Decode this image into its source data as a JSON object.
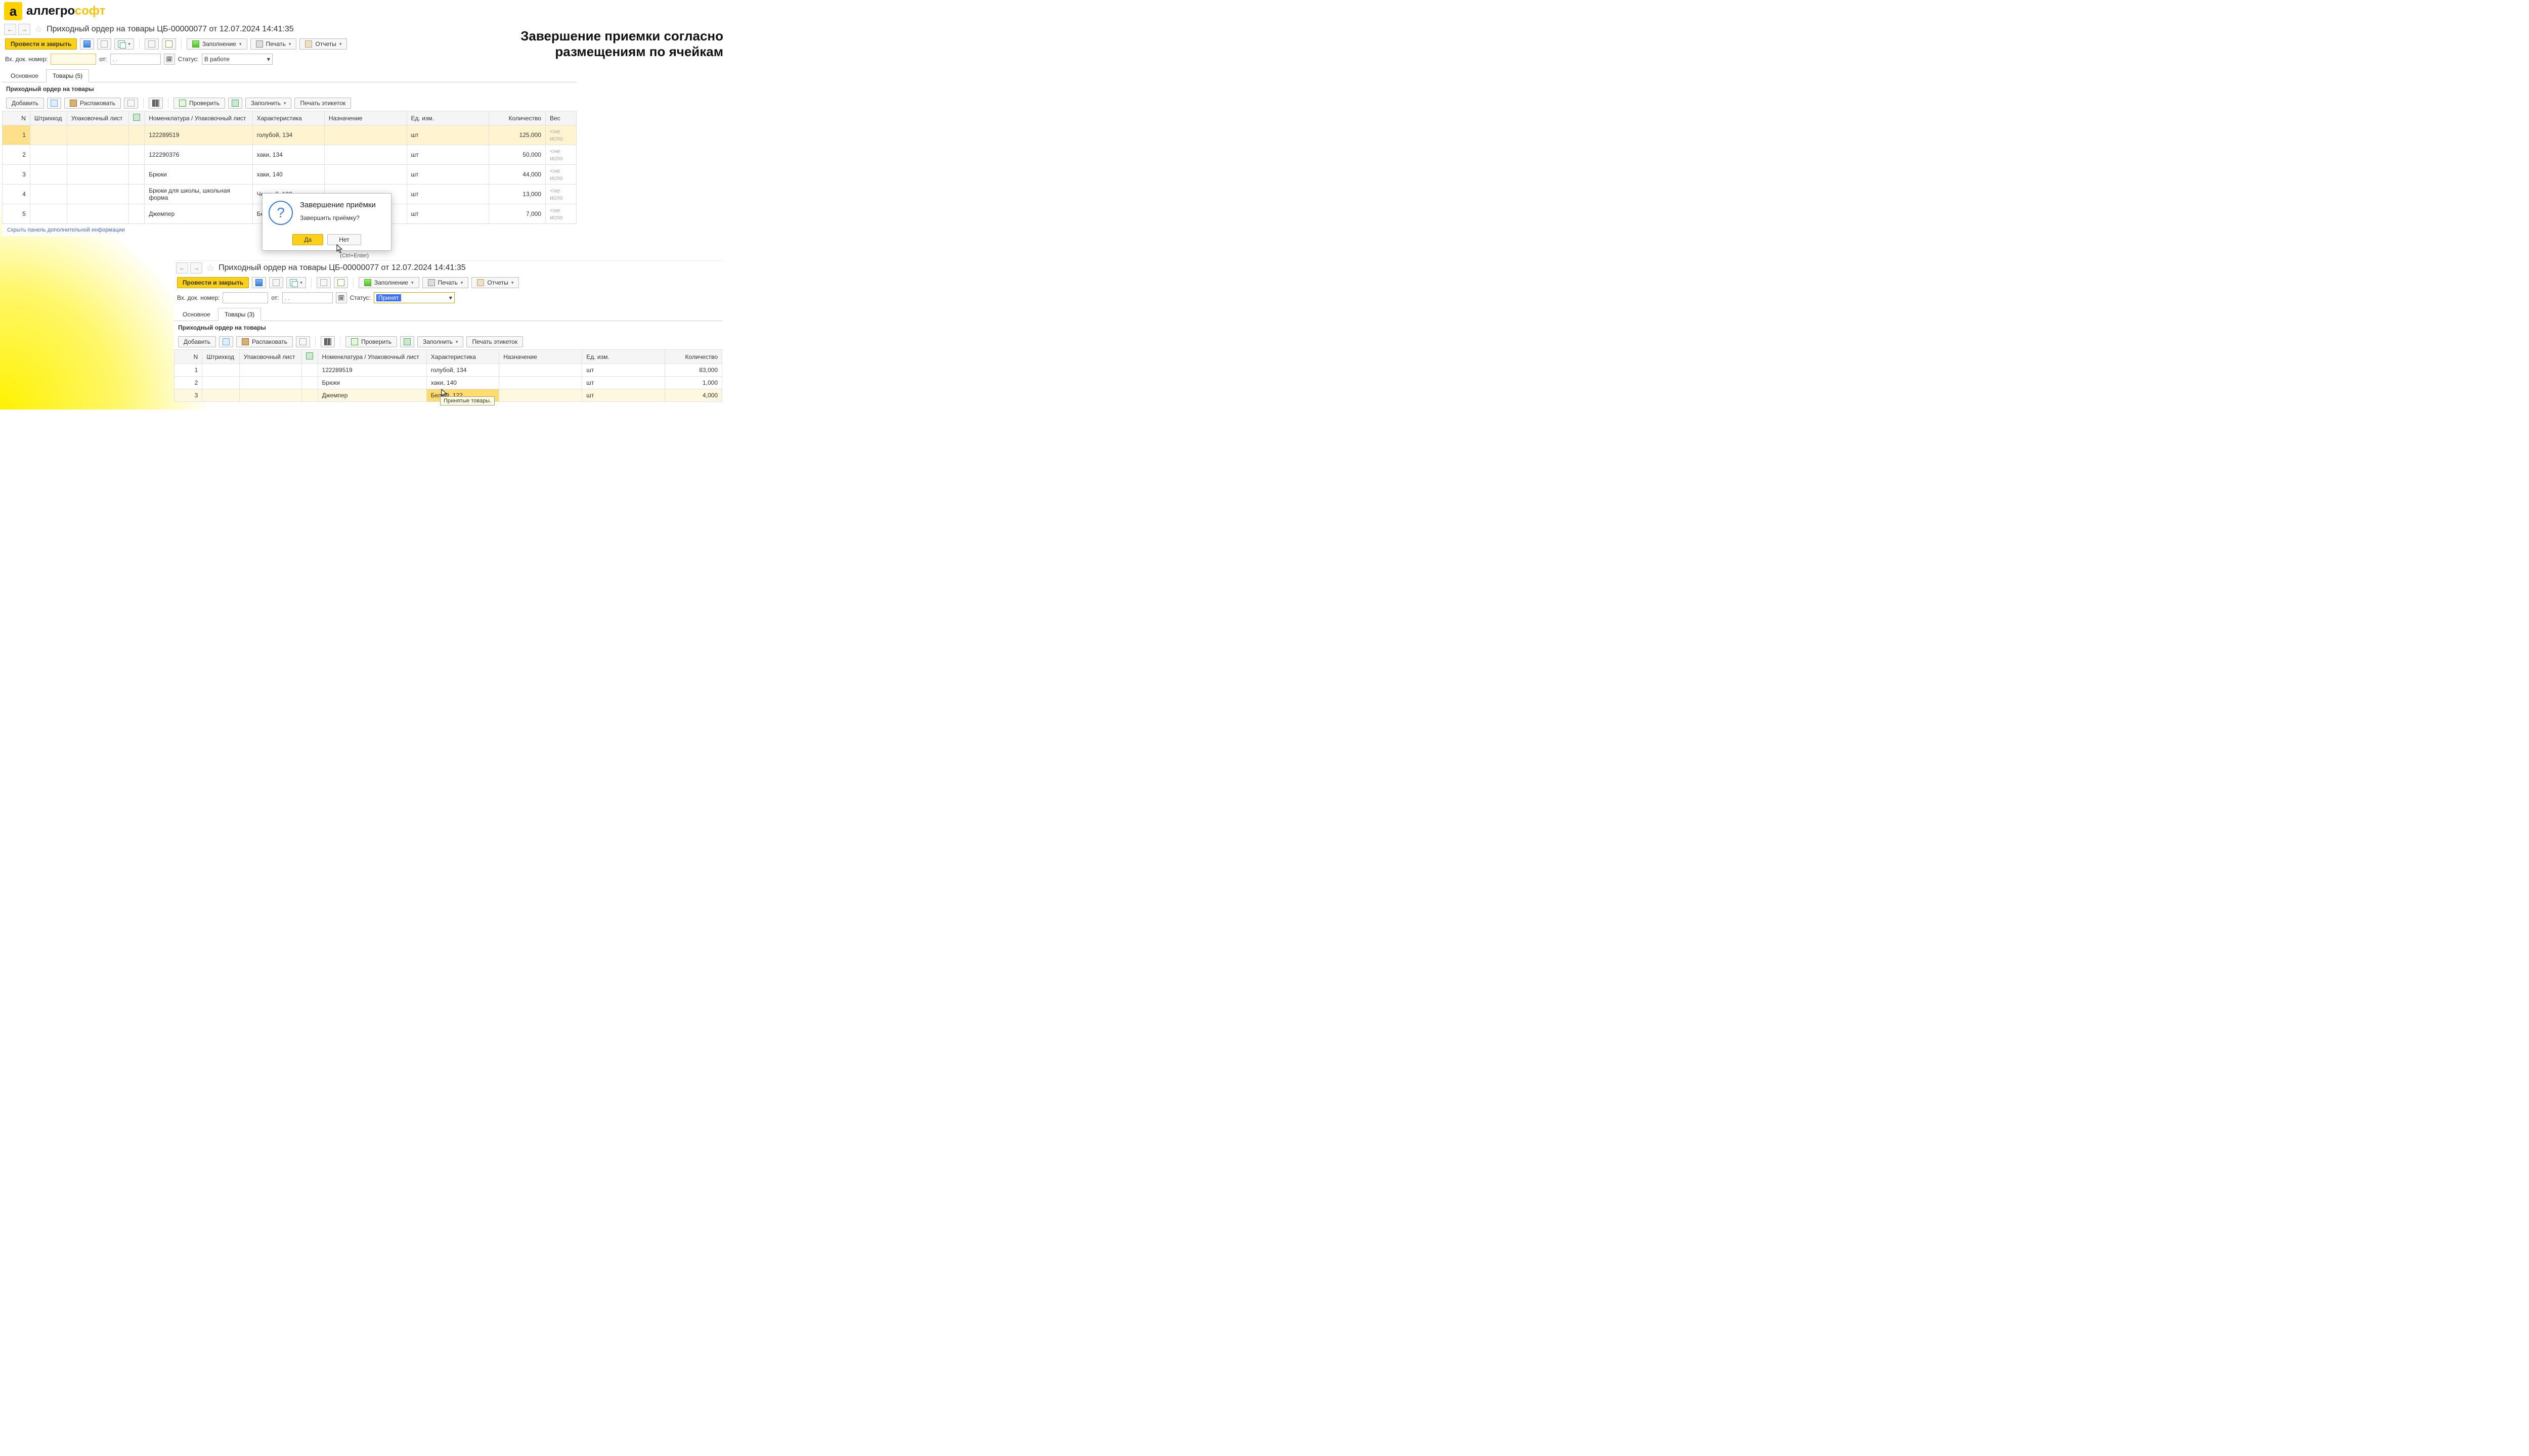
{
  "logo": {
    "part1": "аллегро",
    "part2": "софт",
    "icon": "a"
  },
  "headline_line1": "Завершение приемки согласно",
  "headline_line2": "размещениям по ячейкам",
  "window1": {
    "title": "Приходный ордер на товары ЦБ-00000077 от 12.07.2024 14:41:35",
    "toolbar": {
      "post_close": "Провести и закрыть",
      "fill": "Заполнение",
      "print": "Печать",
      "reports": "Отчеты"
    },
    "fields": {
      "incoming_label": "Вх. док. номер:",
      "from_label": "от:",
      "date_placeholder": ". .",
      "status_label": "Статус:",
      "status_value": "В работе"
    },
    "tabs": {
      "main": "Основное",
      "goods": "Товары (5)"
    },
    "section_title": "Приходный ордер на товары",
    "subtoolbar": {
      "add": "Добавить",
      "unpack": "Распаковать",
      "check": "Проверить",
      "fill": "Заполнить",
      "labels": "Печать этикеток"
    },
    "columns": {
      "n": "N",
      "barcode": "Штрихкод",
      "packlist": "Упаковочный лист",
      "nomen": "Номенклатура / Упаковочный лист",
      "char": "Характеристика",
      "purpose": "Назначение",
      "uom": "Ед. изм.",
      "qty": "Количество",
      "weight": "Вес"
    },
    "rows": [
      {
        "n": "1",
        "nomen": "122289519",
        "char": "голубой, 134",
        "uom": "шт",
        "qty": "125,000",
        "weight": "<не испо"
      },
      {
        "n": "2",
        "nomen": "122290376",
        "char": "хаки, 134",
        "uom": "шт",
        "qty": "50,000",
        "weight": "<не испо"
      },
      {
        "n": "3",
        "nomen": "Брюки",
        "char": "хаки, 140",
        "uom": "шт",
        "qty": "44,000",
        "weight": "<не испо"
      },
      {
        "n": "4",
        "nomen": "Брюки для школы, школьная форма",
        "char": "Черный, 122",
        "uom": "шт",
        "qty": "13,000",
        "weight": "<не испо"
      },
      {
        "n": "5",
        "nomen": "Джемпер",
        "char": "Белый, 122",
        "uom": "шт",
        "qty": "7,000",
        "weight": "<не испо"
      }
    ],
    "hide_panel": "Скрыть панель дополнительной информации"
  },
  "dialog": {
    "title": "Завершение приёмки",
    "message": "Завершить приёмку?",
    "yes": "Да",
    "no": "Нет",
    "shortcut": "(Ctrl+Enter)"
  },
  "window2": {
    "title": "Приходный ордер на товары ЦБ-00000077 от 12.07.2024 14:41:35",
    "toolbar": {
      "post_close": "Провести и закрыть",
      "fill": "Заполнение",
      "print": "Печать",
      "reports": "Отчеты"
    },
    "fields": {
      "incoming_label": "Вх. док. номер:",
      "from_label": "от:",
      "date_placeholder": ". .",
      "status_label": "Статус:",
      "status_value": "Принят"
    },
    "tabs": {
      "main": "Основное",
      "goods": "Товары (3)"
    },
    "section_title": "Приходный ордер на товары",
    "subtoolbar": {
      "add": "Добавить",
      "unpack": "Распаковать",
      "check": "Проверить",
      "fill": "Заполнить",
      "labels": "Печать этикеток"
    },
    "columns": {
      "n": "N",
      "barcode": "Штрихкод",
      "packlist": "Упаковочный лист",
      "nomen": "Номенклатура / Упаковочный лист",
      "char": "Характеристика",
      "purpose": "Назначение",
      "uom": "Ед. изм.",
      "qty": "Количество"
    },
    "rows": [
      {
        "n": "1",
        "nomen": "122289519",
        "char": "голубой, 134",
        "uom": "шт",
        "qty": "83,000"
      },
      {
        "n": "2",
        "nomen": "Брюки",
        "char": "хаки, 140",
        "uom": "шт",
        "qty": "1,000"
      },
      {
        "n": "3",
        "nomen": "Джемпер",
        "char": "Белый, 122",
        "uom": "шт",
        "qty": "4,000"
      }
    ],
    "tooltip": "Принятые товары."
  }
}
